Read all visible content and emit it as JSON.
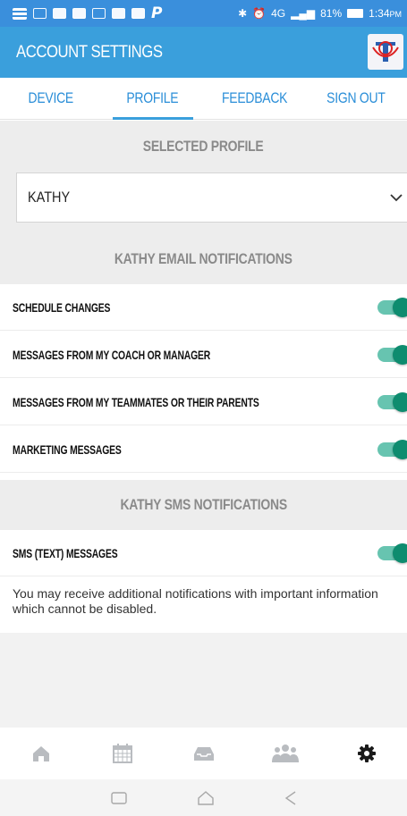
{
  "status_bar": {
    "battery": "81%",
    "network": "4G",
    "time": "1:34",
    "time_suffix": "PM"
  },
  "app_bar": {
    "title": "ACCOUNT SETTINGS",
    "logo_icon": "team-logo-icon"
  },
  "tabs": [
    {
      "label": "DEVICE",
      "active": false
    },
    {
      "label": "PROFILE",
      "active": true
    },
    {
      "label": "FEEDBACK",
      "active": false
    },
    {
      "label": "SIGN OUT",
      "active": false
    }
  ],
  "selected_profile": {
    "header": "SELECTED PROFILE",
    "value": "KATHY"
  },
  "email_notifications": {
    "header": "KATHY EMAIL NOTIFICATIONS",
    "items": [
      {
        "label": "SCHEDULE CHANGES",
        "enabled": true
      },
      {
        "label": "MESSAGES FROM MY COACH OR MANAGER",
        "enabled": true
      },
      {
        "label": "MESSAGES FROM MY TEAMMATES OR THEIR PARENTS",
        "enabled": true
      },
      {
        "label": "MARKETING MESSAGES",
        "enabled": true
      }
    ]
  },
  "sms_notifications": {
    "header": "KATHY SMS NOTIFICATIONS",
    "items": [
      {
        "label": "SMS (TEXT) MESSAGES",
        "enabled": true
      }
    ]
  },
  "note": "You may receive additional notifications with important information which cannot be disabled.",
  "bottom_nav": [
    {
      "icon": "home-icon",
      "active": false
    },
    {
      "icon": "calendar-icon",
      "active": false
    },
    {
      "icon": "inbox-icon",
      "active": false
    },
    {
      "icon": "team-icon",
      "active": false
    },
    {
      "icon": "gear-icon",
      "active": true
    }
  ],
  "colors": {
    "app_bar": "#3a9fdc",
    "tab_text": "#2a8ed8",
    "toggle_on": "#0e8c6f",
    "toggle_track": "#67c4b0",
    "section_bg": "#ededed"
  }
}
